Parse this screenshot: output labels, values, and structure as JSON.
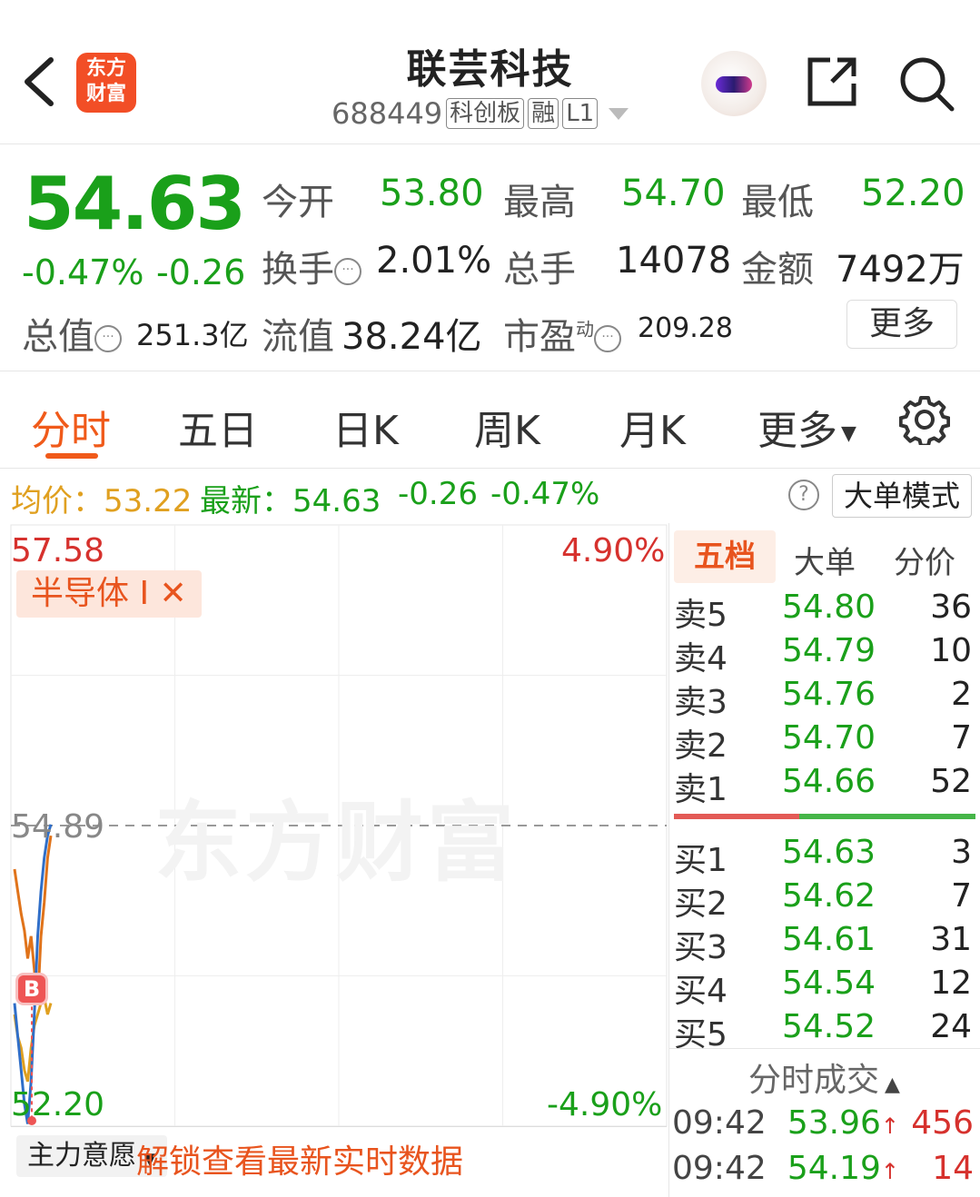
{
  "header": {
    "back_icon": "chevron-left-icon",
    "logo_text": [
      "东方",
      "财富"
    ],
    "title": "联芸科技",
    "code": "688449",
    "tags": [
      "科创板",
      "融",
      "L1"
    ],
    "share_icon": "share-icon",
    "search_icon": "search-icon",
    "assistant_icon": "robot-avatar-icon"
  },
  "quote": {
    "price": "54.63",
    "change_pct": "-0.47%",
    "change": "-0.26",
    "open_label": "今开",
    "open": "53.80",
    "high_label": "最高",
    "high": "54.70",
    "low_label": "最低",
    "low": "52.20",
    "turnover_label": "换手",
    "turnover": "2.01%",
    "volume_label": "总手",
    "volume": "14078",
    "amount_label": "金额",
    "amount": "7492万",
    "mktcap_label": "总值",
    "mktcap": "251.3亿",
    "float_label": "流值",
    "float": "38.24亿",
    "pe_label": "市盈",
    "pe_sup": "动",
    "pe": "209.28",
    "more_label": "更多"
  },
  "tabs": [
    "分时",
    "五日",
    "日K",
    "周K",
    "月K",
    "更多"
  ],
  "info_bar": {
    "avg_label": "均价：",
    "avg": "53.22",
    "latest_label": "最新：",
    "latest": "54.63",
    "change": "-0.26",
    "change_pct": "-0.47%",
    "big_order_label": "大单模式"
  },
  "chart": {
    "top_price": "57.58",
    "top_pct": "4.90%",
    "bottom_price": "52.20",
    "bottom_pct": "-4.90%",
    "ref_price": "54.89",
    "sector_tag": "半导体 I ✕",
    "watermark": "东方财富",
    "marker": "B",
    "bottom_select": "主力意愿",
    "unlock_text": "解锁查看最新实时数据"
  },
  "chart_data": {
    "type": "line",
    "ylim": [
      52.2,
      57.58
    ],
    "reference": 54.89,
    "series": [
      {
        "values": [
          54.5,
          54.3,
          54.1,
          53.95,
          53.7,
          53.9,
          53.6,
          53.3,
          53.9,
          54.2,
          54.6,
          54.8
        ]
      },
      {
        "values": [
          53.2,
          53.0,
          52.9,
          52.7,
          52.6,
          52.9,
          53.1,
          53.2,
          53.3,
          53.35,
          53.2,
          53.3
        ]
      },
      {
        "values": [
          53.3,
          53.0,
          52.7,
          52.4,
          52.22,
          52.6,
          53.2,
          53.9,
          54.3,
          54.6,
          54.8,
          54.9
        ]
      }
    ]
  },
  "book": {
    "tabs": [
      "五档",
      "大单",
      "分价"
    ],
    "sells": [
      {
        "name": "卖5",
        "price": "54.80",
        "vol": "36"
      },
      {
        "name": "卖4",
        "price": "54.79",
        "vol": "10"
      },
      {
        "name": "卖3",
        "price": "54.76",
        "vol": "2"
      },
      {
        "name": "卖2",
        "price": "54.70",
        "vol": "7"
      },
      {
        "name": "卖1",
        "price": "54.66",
        "vol": "52"
      }
    ],
    "buys": [
      {
        "name": "买1",
        "price": "54.63",
        "vol": "3"
      },
      {
        "name": "买2",
        "price": "54.62",
        "vol": "7"
      },
      {
        "name": "买3",
        "price": "54.61",
        "vol": "31"
      },
      {
        "name": "买4",
        "price": "54.54",
        "vol": "12"
      },
      {
        "name": "买5",
        "price": "54.52",
        "vol": "24"
      }
    ],
    "ticks_title": "分时成交",
    "ticks": [
      {
        "time": "09:42",
        "price": "53.96",
        "vol": "456"
      },
      {
        "time": "09:42",
        "price": "54.19",
        "vol": "14"
      }
    ]
  },
  "colors": {
    "up": "#d6312d",
    "down": "#1aa01a",
    "accent": "#f05a1a",
    "avg_line": "#e0a020",
    "price_line": "#2f6ec8"
  }
}
